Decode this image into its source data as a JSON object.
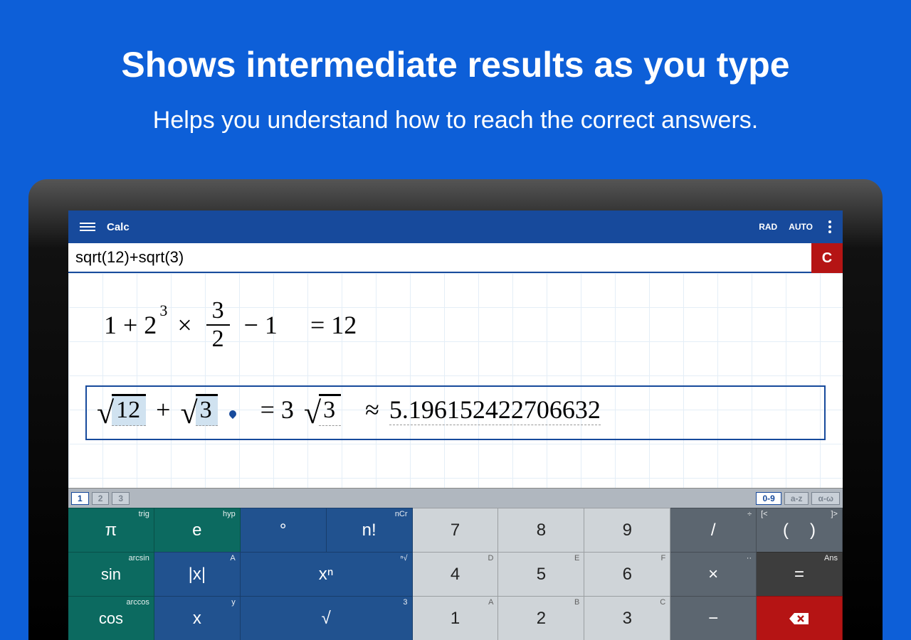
{
  "promo": {
    "title": "Shows intermediate results as you type",
    "subtitle": "Helps you understand how to reach the correct answers."
  },
  "titlebar": {
    "title": "Calc",
    "mode1": "RAD",
    "mode2": "AUTO"
  },
  "input": {
    "expr": "sqrt(12)+sqrt(3)",
    "clear": "C"
  },
  "line1": {
    "a": "1 + 2",
    "exp": "3",
    "mul": "×",
    "frac_n": "3",
    "frac_d": "2",
    "tail": "− 1",
    "eq": "= 12"
  },
  "line2": {
    "arg1": "12",
    "plus": "+",
    "arg2": "3",
    "eq": "= 3",
    "sqarg": "3",
    "approx": "≈",
    "val": "5.196152422706632"
  },
  "tabs": {
    "t1": "1",
    "t2": "2",
    "t3": "3",
    "t4": "0-9",
    "t5": "a-z",
    "t6": "α-ω"
  },
  "keys": {
    "r1": [
      {
        "m": "π",
        "tr": "trig"
      },
      {
        "m": "e",
        "tr": "hyp"
      },
      {
        "m": "°",
        "tr": ""
      },
      {
        "m": "n!",
        "tr": "nCr"
      },
      {
        "m": "7",
        "tr": ""
      },
      {
        "m": "8",
        "tr": ""
      },
      {
        "m": "9",
        "tr": ""
      },
      {
        "m": "/",
        "tr": "÷"
      },
      {
        "m": "(",
        "tl": "[<",
        "tr": "]>",
        "m2": ")"
      }
    ],
    "r2": [
      {
        "m": "sin",
        "tr": "arcsin"
      },
      {
        "m": "|x|",
        "tr": "A"
      },
      {
        "m": "xⁿ",
        "tr": "ⁿ√"
      },
      {
        "m": "4",
        "tr": "D"
      },
      {
        "m": "5",
        "tr": "E"
      },
      {
        "m": "6",
        "tr": "F"
      },
      {
        "m": "×",
        "tr": "··"
      },
      {
        "m": "=",
        "tr": "Ans"
      }
    ],
    "r3": [
      {
        "m": "cos",
        "tr": "arccos"
      },
      {
        "m": "x",
        "tr": "y"
      },
      {
        "m": "√",
        "tr": "3"
      },
      {
        "m": "1",
        "tr": "A"
      },
      {
        "m": "2",
        "tr": "B"
      },
      {
        "m": "3",
        "tr": "C"
      },
      {
        "m": "−",
        "tr": ""
      },
      {
        "m": "⌫",
        "tr": ""
      }
    ]
  }
}
